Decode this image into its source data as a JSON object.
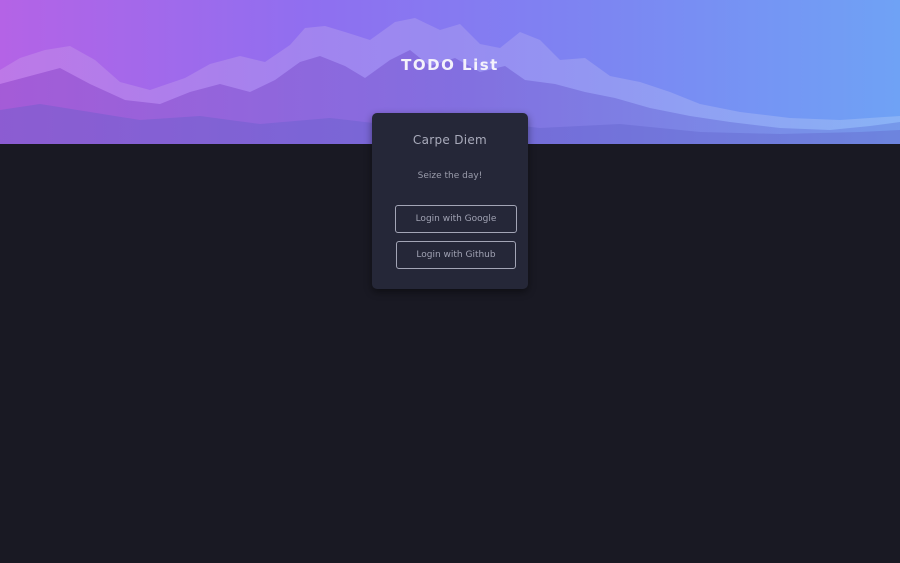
{
  "header": {
    "title": "TODO List"
  },
  "login_card": {
    "title": "Carpe Diem",
    "subtitle": "Seize the day!",
    "google_button_label": "Login with Google",
    "github_button_label": "Login with Github"
  },
  "colors": {
    "page_background": "#191923",
    "card_background": "#252738",
    "banner_gradient_start": "#b463e6",
    "banner_gradient_end": "#6fa2f5"
  }
}
